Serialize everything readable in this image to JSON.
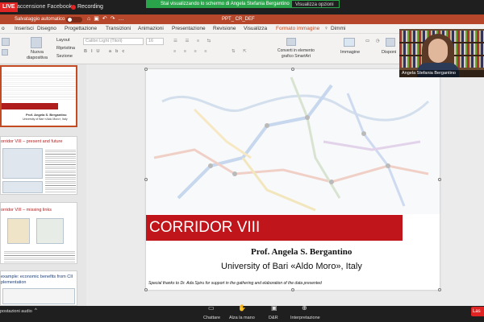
{
  "zoom": {
    "live_badge": "LIVE",
    "live_label": "accensione Facebook",
    "recording_label": "Recording",
    "share_banner": "Stai visualizzando lo schermo di Angela Stefania Bergantino",
    "share_options": "Visualizza opzioni"
  },
  "ppt": {
    "autosave_label": "Salvataggio automatico",
    "doc_title": "PPT_ CR_DEF",
    "tabs": [
      "o",
      "Inserisci",
      "Disegno",
      "Progettazione",
      "Transizioni",
      "Animazioni",
      "Presentazione",
      "Revisione",
      "Visualizza",
      "Formato immagine",
      "Dimmi"
    ],
    "active_tab": "Formato immagine",
    "ribbon": {
      "new_slide_label": "Nuova\ndiapositiva",
      "layout_label": "Layout",
      "reset_label": "Ripristina",
      "section_label": "Sezione",
      "font_name": "Calibri Light (Titoli)",
      "font_size": "16",
      "smartart_label": "Converti in elemento\ngrafico SmartArt",
      "image_label": "Immagine",
      "arrange_label": "Disponi"
    }
  },
  "slides_pane": {
    "thumbnails": [
      {
        "title": "CORRIDOR VIII",
        "line1": "Prof. Angela S. Bergantino",
        "line2": "University of Bari «Aldo Moro», Italy"
      },
      {
        "title": "orridor VIII – present and future"
      },
      {
        "title": "orridor VIII – missing links"
      },
      {
        "title": "example: economic benefits from CII",
        "title_line2": "plementation"
      }
    ]
  },
  "slide": {
    "title": "CORRIDOR VIII",
    "author": "Prof. Angela S. Bergantino",
    "affiliation": "University of Bari «Aldo Moro», Italy",
    "thanks": "Special thanks to Dr. Ada Spiru for support in the gathering and elaboration of the data presented"
  },
  "webcam": {
    "name": "Angela Stefania Bergantino"
  },
  "bottom_bar": {
    "audio_label": "postazioni audio",
    "chat_label": "Chattare",
    "raise_hand_label": "Alza la mano",
    "qa_label": "D&R",
    "interpretation_label": "Interpretazione",
    "leave_label": "Las"
  },
  "colors": {
    "ppt_accent": "#b7472a",
    "slide_title_red": "#c0151a",
    "share_green": "#2aa44a",
    "live_red": "#e02424"
  }
}
